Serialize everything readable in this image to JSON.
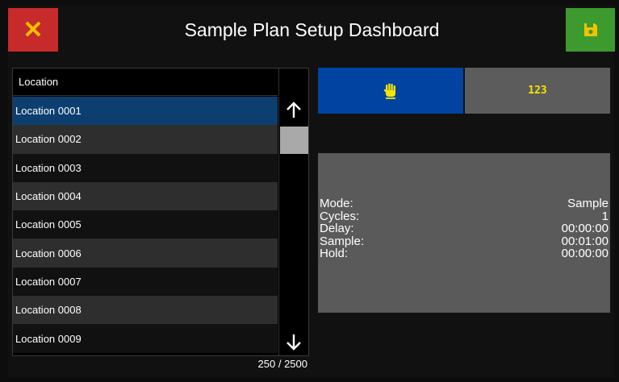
{
  "header": {
    "title": "Sample Plan Setup Dashboard",
    "close_symbol": "✕",
    "close_icon": "close-icon",
    "save_icon": "floppy-disk-icon"
  },
  "list": {
    "column_header": "Location",
    "items": [
      "Location 0001",
      "Location 0002",
      "Location 0003",
      "Location 0004",
      "Location 0005",
      "Location 0006",
      "Location 0007",
      "Location 0008",
      "Location 0009"
    ],
    "selected_index": 0,
    "counter": "250 / 2500"
  },
  "mode_buttons": {
    "manual_icon": "hand-icon",
    "auto_label": "123"
  },
  "info": {
    "rows": [
      {
        "label": "Mode:",
        "value": "Sample"
      },
      {
        "label": "Cycles:",
        "value": "1"
      },
      {
        "label": "Delay:",
        "value": "00:00:00"
      },
      {
        "label": "Sample:",
        "value": "00:01:00"
      },
      {
        "label": "Hold:",
        "value": "00:00:00"
      }
    ]
  },
  "colors": {
    "close_bg": "#c62a2a",
    "save_bg": "#3c9a2e",
    "accent_yellow": "#f5c200",
    "selected_row": "#0c3f70",
    "manual_bg": "#0043a1",
    "panel_gray": "#5a5a5a"
  }
}
